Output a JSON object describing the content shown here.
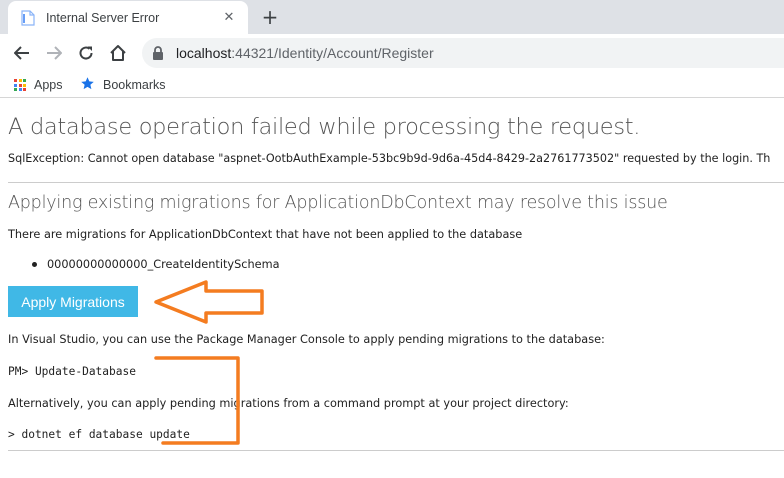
{
  "browser": {
    "tab": {
      "title": "Internal Server Error",
      "close_glyph": "✕"
    },
    "new_tab_glyph": "+",
    "address": {
      "host": "localhost",
      "rest": ":44321/Identity/Account/Register"
    },
    "bookmarks": [
      {
        "label": "Apps",
        "icon": "apps-grid-icon"
      },
      {
        "label": "Bookmarks",
        "icon": "star-icon"
      }
    ],
    "colors": {
      "tabstrip": "#dee1e6",
      "omnibox": "#f1f3f4",
      "star": "#1a73e8"
    }
  },
  "page": {
    "title": "A database operation failed while processing the request.",
    "sql_message": "SqlException: Cannot open database \"aspnet-OotbAuthExample-53bc9b9d-9d6a-45d4-8429-2a2761773502\" requested by the login. Th",
    "subtitle": "Applying existing migrations for ApplicationDbContext may resolve this issue",
    "pending_text": "There are migrations for ApplicationDbContext that have not been applied to the database",
    "migrations": [
      "00000000000000_CreateIdentitySchema"
    ],
    "apply_button_label": "Apply Migrations",
    "vs_text": "In Visual Studio, you can use the Package Manager Console to apply pending migrations to the database:",
    "pm_command": "PM> Update-Database",
    "alt_text": "Alternatively, you can apply pending migrations from a command prompt at your project directory:",
    "cli_command": "> dotnet ef database update",
    "colors": {
      "button": "#40b8e6",
      "annotation": "#f47c20",
      "heading": "#555555"
    }
  }
}
